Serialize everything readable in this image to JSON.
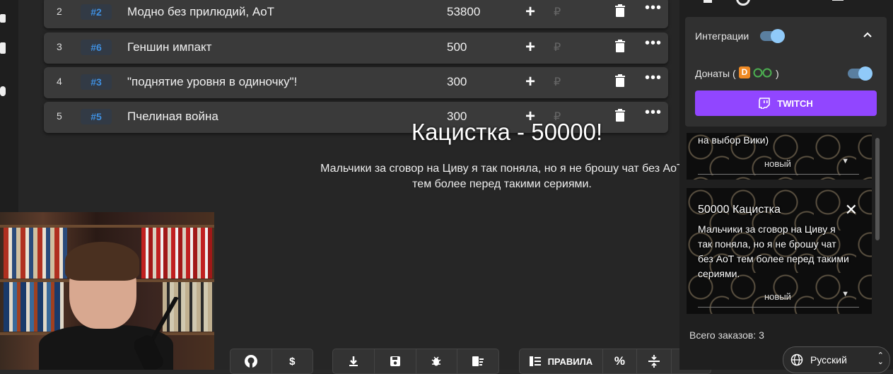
{
  "rows": [
    {
      "num": "2",
      "badge": "#2",
      "title": "Модно без прилюдий, AoT",
      "amount": "53800"
    },
    {
      "num": "3",
      "badge": "#6",
      "title": "Геншин импакт",
      "amount": "500"
    },
    {
      "num": "4",
      "badge": "#3",
      "title": " \"поднятие уровня в одиночку\"!",
      "amount": "300"
    },
    {
      "num": "5",
      "badge": "#5",
      "title": "Пчелиная война",
      "amount": "300"
    }
  ],
  "row_actions": {
    "plus": "+",
    "currency": "₽",
    "more": "•••"
  },
  "overlay": {
    "title": "Кацистка - 50000!",
    "message": "Мальчики за сговор на Циву я так поняла, но я не брошу чат без AoT тем более перед такими сериями."
  },
  "sidebar": {
    "integrations_label": "Интеграции",
    "donations_label": "Донаты (",
    "donations_suffix": ")",
    "twitch_label": "TWITCH",
    "card1": {
      "text": "на выбор Вики)",
      "status": "новый"
    },
    "card2": {
      "title": "50000 Кацистка",
      "lines": [
        "Мальчики за сговор на Циву я",
        "так поняла, но я не брошу чат",
        "без AoT тем более перед такими",
        "сериями."
      ],
      "status": "новый"
    },
    "total_orders": "Всего заказов: 3",
    "language": "Русский"
  },
  "toolbar": {
    "rules_label": "ПРАВИЛА",
    "icons": [
      "github-icon",
      "dollar-icon",
      "download-icon",
      "save-icon",
      "bug-icon",
      "clear-list-icon",
      "rules-icon",
      "percent-icon",
      "split-icon",
      "sort-icon"
    ]
  },
  "colors": {
    "accent_blue": "#3f8fe0",
    "twitch": "#9146ff",
    "toggle_knob": "#90caf9"
  }
}
